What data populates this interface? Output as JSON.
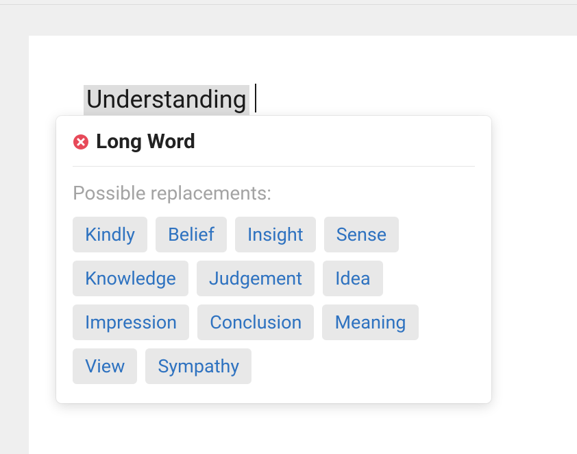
{
  "editor": {
    "highlighted_word": "Understanding"
  },
  "popup": {
    "title": "Long Word",
    "subtitle": "Possible replacements:",
    "replacements": [
      "Kindly",
      "Belief",
      "Insight",
      "Sense",
      "Knowledge",
      "Judgement",
      "Idea",
      "Impression",
      "Conclusion",
      "Meaning",
      "View",
      "Sympathy"
    ]
  }
}
